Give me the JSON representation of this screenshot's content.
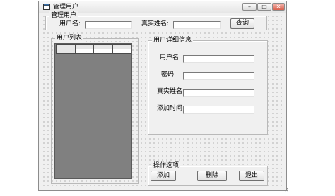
{
  "window": {
    "title": "管理用户",
    "minimize_glyph": "–",
    "maximize_glyph": "□",
    "close_glyph": "✕"
  },
  "search_group": {
    "legend": "管理用户",
    "username_label": "用户名:",
    "username_value": "",
    "realname_label": "真实姓名:",
    "realname_value": "",
    "query_button": "查询"
  },
  "user_list_group": {
    "legend": "用户列表",
    "grid": {
      "columns": [
        "",
        "",
        ""
      ],
      "rows": [
        [
          "",
          "",
          "",
          ""
        ]
      ]
    }
  },
  "detail_group": {
    "legend": "用户详细信息",
    "fields": [
      {
        "label": "用户名:",
        "value": ""
      },
      {
        "label": "密码:",
        "value": ""
      },
      {
        "label": "真实姓名:",
        "value": ""
      },
      {
        "label": "添加时间:",
        "value": ""
      }
    ]
  },
  "options_group": {
    "legend": "操作选项",
    "add_button": "添加",
    "delete_button": "删除",
    "exit_button": "退出"
  },
  "icons": {
    "title_icon": "window-app-icon",
    "resize_grip": "resize-grip-icon"
  }
}
